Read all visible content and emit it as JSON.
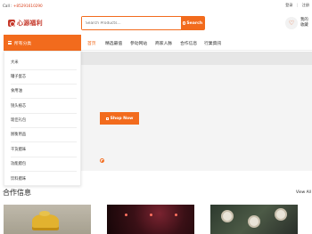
{
  "topbar": {
    "call_label": "Call :",
    "phone": "+85291610290",
    "login": "登录",
    "separator": "|",
    "register": "注册"
  },
  "header": {
    "logo_text": "心源福利",
    "search_placeholder": "Search Products...",
    "search_button": "Search",
    "wishlist_label": "我的\n收藏"
  },
  "categories": {
    "button_label": "所有分类",
    "items": [
      "大米",
      "罐子蛋芯",
      "食用油",
      "锐头植芯",
      "现佳礼包",
      "厨衡用品",
      "干货腊味",
      "功能腊包",
      "饮料腊味"
    ]
  },
  "nav": {
    "items": [
      "首页",
      "精选最值",
      "参动网站",
      "商家人脉",
      "合作信息",
      "行業資訊"
    ],
    "active_index": 0
  },
  "hero": {
    "cta_label": "Shop Now"
  },
  "section": {
    "title": "合作信息",
    "view_all": "View All"
  },
  "colors": {
    "accent": "#f26b1d",
    "brand": "#c5382a"
  }
}
